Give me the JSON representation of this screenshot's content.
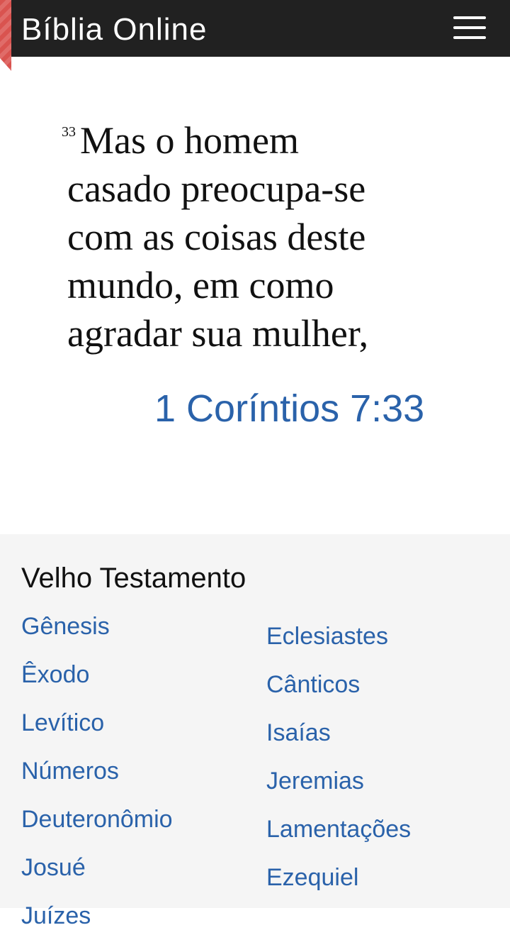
{
  "header": {
    "title": "Bíblia Online",
    "menu_icon": "hamburger-menu-icon"
  },
  "verse": {
    "number": "33",
    "lines": [
      "Mas o homem",
      "casado preocupa-se",
      "com as coisas deste",
      "mundo, em como",
      "agradar sua mulher,"
    ],
    "reference": "1 Coríntios 7:33"
  },
  "books": {
    "section_title": "Velho Testamento",
    "left": [
      "Gênesis",
      "Êxodo",
      "Levítico",
      "Números",
      "Deuteronômio",
      "Josué",
      "Juízes"
    ],
    "right": [
      "Eclesiastes",
      "Cânticos",
      "Isaías",
      "Jeremias",
      "Lamentações",
      "Ezequiel"
    ]
  },
  "colors": {
    "header_bg": "#212121",
    "link": "#2a62aa",
    "panel_bg": "#f5f5f5",
    "ribbon": "#d9534f"
  }
}
